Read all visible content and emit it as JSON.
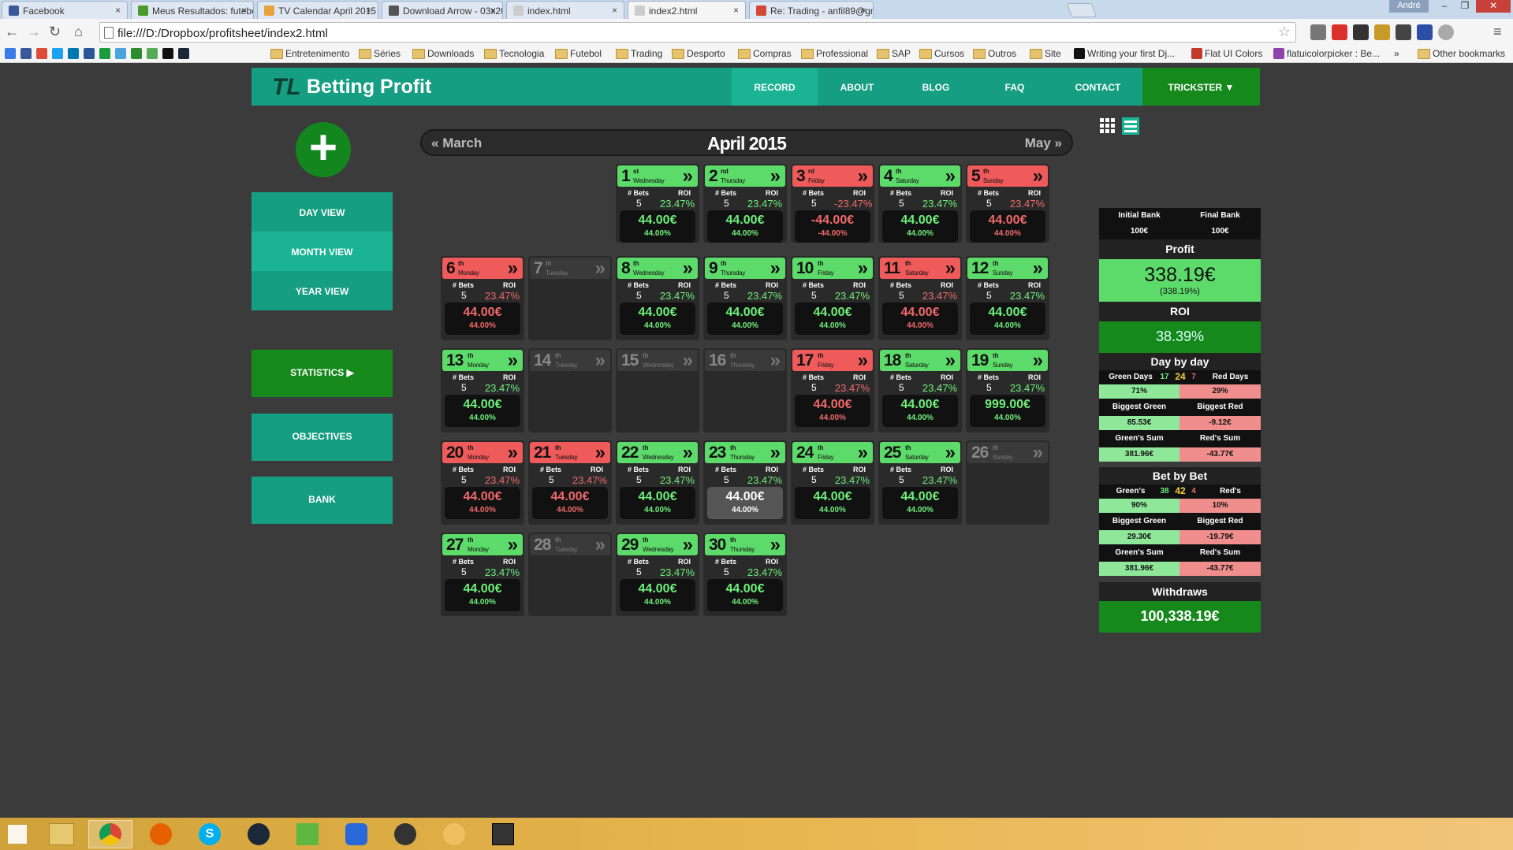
{
  "browser": {
    "tabs": [
      {
        "title": "Facebook",
        "color": "#3b5998",
        "active": false
      },
      {
        "title": "Meus Resultados: futebol",
        "color": "#4c9a2a",
        "active": false
      },
      {
        "title": "TV Calendar April 2015 - ",
        "color": "#e9a13b",
        "active": false
      },
      {
        "title": "Download Arrow - 03x20",
        "color": "#555",
        "active": false
      },
      {
        "title": "index.html",
        "color": "#ccc",
        "active": false
      },
      {
        "title": "index2.html",
        "color": "#ccc",
        "active": true
      },
      {
        "title": "Re: Trading - anfil89@gm",
        "color": "#d14836",
        "active": false
      }
    ],
    "window_user": "André",
    "url": "file:///D:/Dropbox/profitsheet/index2.html",
    "bookmarks": [
      "Entretenimento",
      "Séries",
      "Downloads",
      "Tecnologia",
      "Futebol",
      "Trading",
      "Desporto",
      "Compras",
      "Professional",
      "SAP",
      "Cursos",
      "Outros",
      "Site"
    ],
    "bookmark_links": [
      "Writing your first Dj...",
      "Flat UI Colors",
      "flatuicolorpicker : Be..."
    ],
    "other_bookmarks": "Other bookmarks",
    "overflow": "»"
  },
  "header": {
    "logo_mark": "TL",
    "logo_text": "Betting Profit",
    "nav": [
      "RECORD",
      "ABOUT",
      "BLOG",
      "FAQ",
      "CONTACT"
    ],
    "user_menu": "TRICKSTER ▼"
  },
  "sidebar": {
    "add": "+",
    "items": [
      "DAY VIEW",
      "MONTH VIEW",
      "YEAR VIEW",
      "STATISTICS  ▶",
      "OBJECTIVES",
      "BANK"
    ]
  },
  "calendar": {
    "prev": "March",
    "current": "April 2015",
    "next": "May",
    "bets_label": "# Bets",
    "roi_label": "ROI",
    "days": [
      {
        "d": "1",
        "sup": "st",
        "name": "Wednesday",
        "status": "green",
        "bets": "5",
        "roi": "23.47%",
        "profit": "44.00€",
        "pct": "44.00%"
      },
      {
        "d": "2",
        "sup": "nd",
        "name": "Thursday",
        "status": "green",
        "bets": "5",
        "roi": "23.47%",
        "profit": "44.00€",
        "pct": "44.00%"
      },
      {
        "d": "3",
        "sup": "rd",
        "name": "Friday",
        "status": "red",
        "bets": "5",
        "roi": "-23.47%",
        "profit": "-44.00€",
        "pct": "-44.00%"
      },
      {
        "d": "4",
        "sup": "th",
        "name": "Saturday",
        "status": "green",
        "bets": "5",
        "roi": "23.47%",
        "profit": "44.00€",
        "pct": "44.00%"
      },
      {
        "d": "5",
        "sup": "th",
        "name": "Sunday",
        "status": "red",
        "bets": "5",
        "roi": "23.47%",
        "profit": "44.00€",
        "pct": "44.00%"
      },
      {
        "d": "6",
        "sup": "th",
        "name": "Monday",
        "status": "red",
        "bets": "5",
        "roi": "23.47%",
        "profit": "44.00€",
        "pct": "44.00%"
      },
      {
        "d": "7",
        "sup": "th",
        "name": "Tuesday",
        "status": "grey"
      },
      {
        "d": "8",
        "sup": "th",
        "name": "Wednesday",
        "status": "green",
        "bets": "5",
        "roi": "23.47%",
        "profit": "44.00€",
        "pct": "44.00%"
      },
      {
        "d": "9",
        "sup": "th",
        "name": "Thursday",
        "status": "green",
        "bets": "5",
        "roi": "23.47%",
        "profit": "44.00€",
        "pct": "44.00%"
      },
      {
        "d": "10",
        "sup": "th",
        "name": "Friday",
        "status": "green",
        "bets": "5",
        "roi": "23.47%",
        "profit": "44.00€",
        "pct": "44.00%"
      },
      {
        "d": "11",
        "sup": "th",
        "name": "Saturday",
        "status": "red",
        "bets": "5",
        "roi": "23.47%",
        "profit": "44.00€",
        "pct": "44.00%"
      },
      {
        "d": "12",
        "sup": "th",
        "name": "Sunday",
        "status": "green",
        "bets": "5",
        "roi": "23.47%",
        "profit": "44.00€",
        "pct": "44.00%"
      },
      {
        "d": "13",
        "sup": "th",
        "name": "Monday",
        "status": "green",
        "bets": "5",
        "roi": "23.47%",
        "profit": "44.00€",
        "pct": "44.00%"
      },
      {
        "d": "14",
        "sup": "th",
        "name": "Tuesday",
        "status": "grey"
      },
      {
        "d": "15",
        "sup": "th",
        "name": "Wednesday",
        "status": "grey"
      },
      {
        "d": "16",
        "sup": "th",
        "name": "Thursday",
        "status": "grey"
      },
      {
        "d": "17",
        "sup": "th",
        "name": "Friday",
        "status": "red",
        "bets": "5",
        "roi": "23.47%",
        "profit": "44.00€",
        "pct": "44.00%"
      },
      {
        "d": "18",
        "sup": "th",
        "name": "Saturday",
        "status": "green",
        "bets": "5",
        "roi": "23.47%",
        "profit": "44.00€",
        "pct": "44.00%"
      },
      {
        "d": "19",
        "sup": "th",
        "name": "Sunday",
        "status": "green",
        "bets": "5",
        "roi": "23.47%",
        "profit": "999.00€",
        "pct": "44.00%"
      },
      {
        "d": "20",
        "sup": "th",
        "name": "Monday",
        "status": "red",
        "bets": "5",
        "roi": "23.47%",
        "profit": "44.00€",
        "pct": "44.00%"
      },
      {
        "d": "21",
        "sup": "th",
        "name": "Tuesday",
        "status": "red",
        "bets": "5",
        "roi": "23.47%",
        "profit": "44.00€",
        "pct": "44.00%"
      },
      {
        "d": "22",
        "sup": "th",
        "name": "Wednesday",
        "status": "green",
        "bets": "5",
        "roi": "23.47%",
        "profit": "44.00€",
        "pct": "44.00%"
      },
      {
        "d": "23",
        "sup": "th",
        "name": "Thursday",
        "status": "green",
        "bets": "5",
        "roi": "23.47%",
        "profit": "44.00€",
        "pct": "44.00%",
        "highlight": true
      },
      {
        "d": "24",
        "sup": "th",
        "name": "Friday",
        "status": "green",
        "bets": "5",
        "roi": "23.47%",
        "profit": "44.00€",
        "pct": "44.00%"
      },
      {
        "d": "25",
        "sup": "th",
        "name": "Saturday",
        "status": "green",
        "bets": "5",
        "roi": "23.47%",
        "profit": "44.00€",
        "pct": "44.00%"
      },
      {
        "d": "26",
        "sup": "th",
        "name": "Sunday",
        "status": "grey"
      },
      {
        "d": "27",
        "sup": "th",
        "name": "Monday",
        "status": "green",
        "bets": "5",
        "roi": "23.47%",
        "profit": "44.00€",
        "pct": "44.00%"
      },
      {
        "d": "28",
        "sup": "th",
        "name": "Tuesday",
        "status": "grey"
      },
      {
        "d": "29",
        "sup": "th",
        "name": "Wednesday",
        "status": "green",
        "bets": "5",
        "roi": "23.47%",
        "profit": "44.00€",
        "pct": "44.00%"
      },
      {
        "d": "30",
        "sup": "th",
        "name": "Thursday",
        "status": "green",
        "bets": "5",
        "roi": "23.47%",
        "profit": "44.00€",
        "pct": "44.00%"
      }
    ]
  },
  "stats": {
    "initial_bank_label": "Initial Bank",
    "final_bank_label": "Final Bank",
    "initial_bank": "100€",
    "final_bank": "100€",
    "profit_label": "Profit",
    "profit": "338.19€",
    "profit_pct": "(338.19%)",
    "roi_label": "ROI",
    "roi": "38.39%",
    "day_title": "Day by day",
    "day": {
      "green_label": "Green Days",
      "green": "17",
      "total": "24",
      "red": "7",
      "red_label": "Red Days",
      "green_pct": "71%",
      "red_pct": "29%",
      "biggest_green_label": "Biggest Green",
      "biggest_red_label": "Biggest Red",
      "biggest_green": "85.53€",
      "biggest_red": "-9.12€",
      "green_sum_label": "Green's Sum",
      "red_sum_label": "Red's Sum",
      "green_sum": "381.96€",
      "red_sum": "-43.77€"
    },
    "bet_title": "Bet by Bet",
    "bet": {
      "green_label": "Green's",
      "green": "38",
      "total": "42",
      "red": "4",
      "red_label": "Red's",
      "green_pct": "90%",
      "red_pct": "10%",
      "biggest_green_label": "Biggest Green",
      "biggest_red_label": "Biggest Red",
      "biggest_green": "29.30€",
      "biggest_red": "-19.79€",
      "green_sum_label": "Green's Sum",
      "red_sum_label": "Red's Sum",
      "green_sum": "381.96€",
      "red_sum": "-43.77€"
    },
    "withdraws_label": "Withdraws",
    "withdraws": "100,338.19€"
  }
}
